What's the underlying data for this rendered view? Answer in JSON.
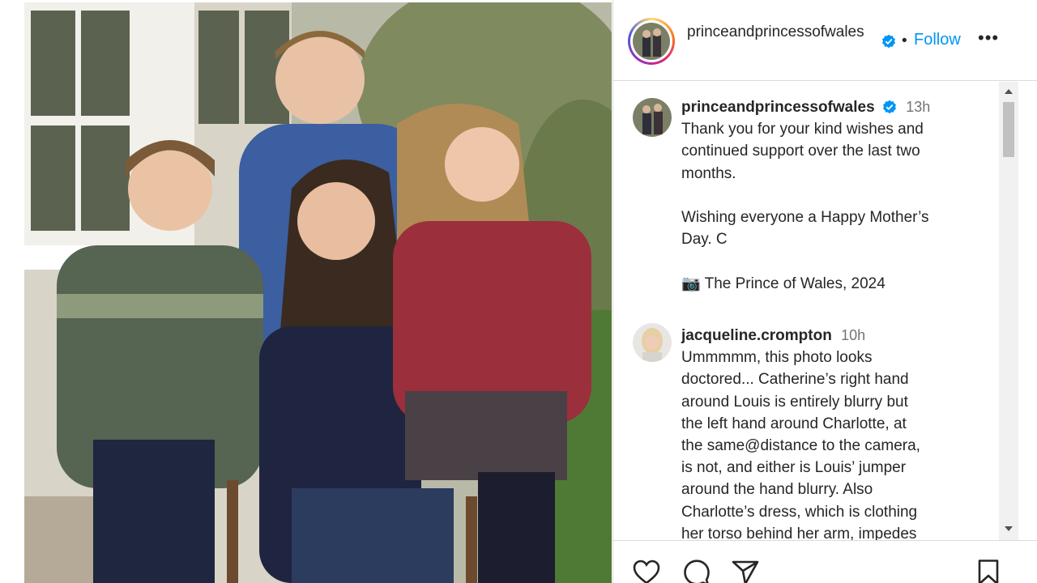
{
  "post": {
    "username": "princeandprincessofwales",
    "follow_label": "Follow",
    "separator": "•",
    "more_label": "•••"
  },
  "caption": {
    "username": "princeandprincessofwales",
    "time": "13h",
    "lines": [
      "Thank you for your kind wishes and",
      "continued support over the last two",
      "months."
    ],
    "lines2": [
      "Wishing everyone a Happy Mother’s",
      "Day. C"
    ],
    "credit": "📷 The Prince of Wales, 2024"
  },
  "comment": {
    "username": "jacqueline.crompton",
    "time": "10h",
    "lines": [
      "Ummmmm, this photo looks",
      "doctored... Catherine’s right hand",
      "around Louis is entirely blurry but",
      "the left hand around Charlotte, at",
      "the same@distance to the camera,",
      "is not, and either is Louis’ jumper",
      "around the hand blurry. Also",
      "Charlotte’s dress, which is clothing",
      "her torso behind her arm, impedes"
    ]
  },
  "colors": {
    "accent": "#0095f6",
    "verified": "#0095f6",
    "text": "#262626",
    "muted": "#737373"
  },
  "icons": [
    "heart-icon",
    "comment-icon",
    "share-icon",
    "bookmark-icon",
    "verified-icon",
    "more-icon"
  ]
}
